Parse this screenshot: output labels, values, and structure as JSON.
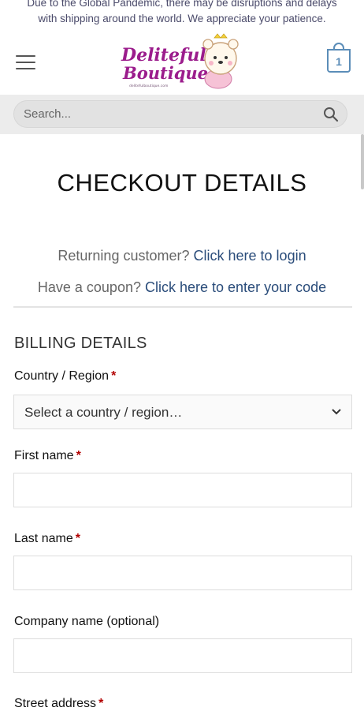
{
  "notice": {
    "line1": "Due to the Global Pandemic, there may be disruptions and delays",
    "line2": "with shipping around the world. We appreciate your patience."
  },
  "header": {
    "logo_line1": "Deliteful",
    "logo_line2": "Boutique",
    "logo_url": "delitefulboutique.com",
    "cart_count": "1"
  },
  "search": {
    "placeholder": "Search..."
  },
  "page": {
    "title": "CHECKOUT DETAILS",
    "returning_text": "Returning customer?",
    "returning_link": "Click here to login",
    "coupon_text": "Have a coupon?",
    "coupon_link": "Click here to enter your code"
  },
  "billing": {
    "heading": "BILLING DETAILS",
    "country_label": "Country / Region",
    "country_value": "Select a country / region…",
    "first_name_label": "First name",
    "last_name_label": "Last name",
    "company_label": "Company name (optional)",
    "street_label": "Street address",
    "required_mark": "*"
  },
  "colors": {
    "accent": "#5b8db8",
    "link": "#2a4c7a",
    "required": "#b20000",
    "logo": "#9b1c8c"
  }
}
